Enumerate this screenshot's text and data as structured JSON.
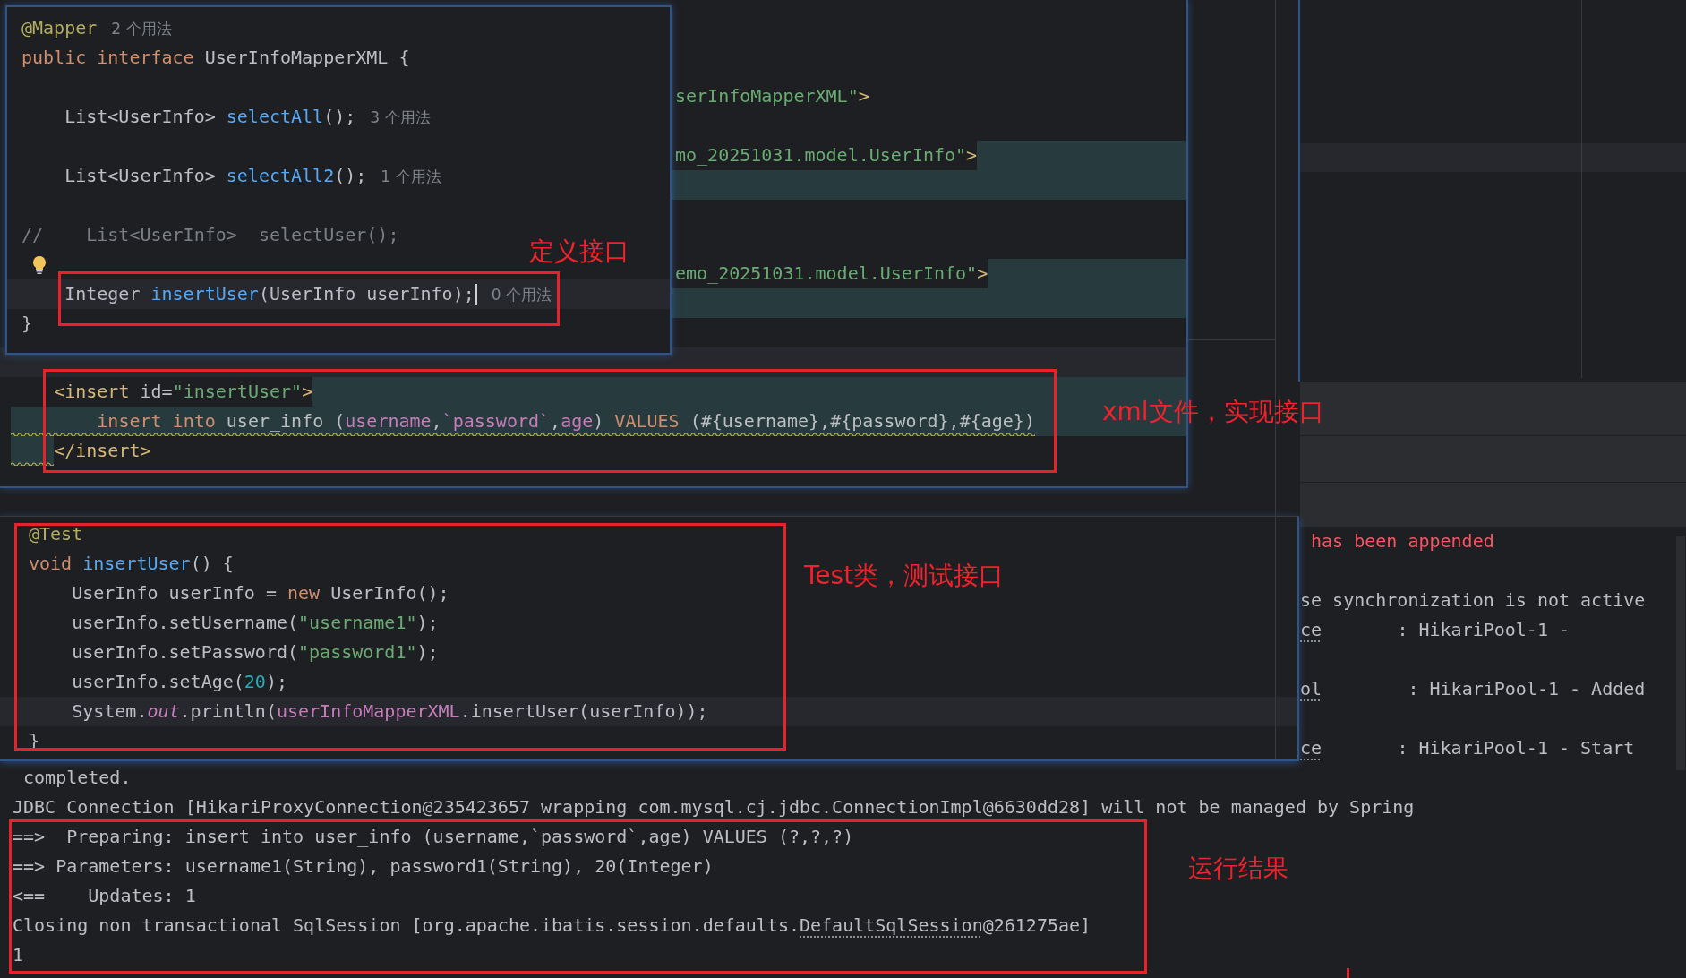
{
  "interface_editor": {
    "note": "定义接口",
    "lines": [
      {
        "kind": "code",
        "current": false,
        "tokens": [
          {
            "kind": "annotation",
            "text": "@Mapper"
          }
        ],
        "hint": "2 个用法"
      },
      {
        "kind": "code",
        "current": false,
        "tokens": [
          {
            "kind": "keyword",
            "text": "public interface"
          },
          {
            "kind": "plain",
            "text": " UserInfoMapperXML {"
          }
        ]
      },
      {
        "kind": "blank",
        "current": false
      },
      {
        "kind": "code",
        "current": false,
        "tokens": [
          {
            "kind": "plain",
            "text": "    List<UserInfo> "
          },
          {
            "kind": "method",
            "text": "selectAll"
          },
          {
            "kind": "plain",
            "text": "();"
          }
        ],
        "hint": "3 个用法"
      },
      {
        "kind": "blank",
        "current": false
      },
      {
        "kind": "code",
        "current": false,
        "tokens": [
          {
            "kind": "plain",
            "text": "    List<UserInfo> "
          },
          {
            "kind": "method",
            "text": "selectAll2"
          },
          {
            "kind": "plain",
            "text": "();"
          }
        ],
        "hint": "1 个用法"
      },
      {
        "kind": "blank",
        "current": false
      },
      {
        "kind": "code",
        "current": false,
        "tokens": [
          {
            "kind": "comment",
            "text": "//    List<UserInfo>  selectUser();"
          }
        ]
      },
      {
        "kind": "bulb",
        "current": false
      },
      {
        "kind": "code",
        "current": true,
        "tokens": [
          {
            "kind": "plain",
            "text": "    Integer "
          },
          {
            "kind": "method",
            "text": "insertUser"
          },
          {
            "kind": "plain",
            "text": "(UserInfo userInfo);"
          },
          {
            "kind": "caret"
          }
        ],
        "hint": "0 个用法"
      },
      {
        "kind": "code",
        "current": false,
        "tokens": [
          {
            "kind": "plain",
            "text": "}"
          }
        ]
      }
    ]
  },
  "xml_editor": {
    "note": "xml文件，实现接口",
    "lines": [
      {
        "kind": "clipped",
        "current": false,
        "band": false,
        "tokens": [
          {
            "kind": "string",
            "text": "serInfoMapperXML\""
          },
          {
            "kind": "tag",
            "text": ">"
          }
        ]
      },
      {
        "kind": "blank",
        "current": false,
        "band": false
      },
      {
        "kind": "clipped",
        "current": false,
        "band": false,
        "tokens": [
          {
            "kind": "string",
            "text": "mo_20251031.model.UserInfo\""
          },
          {
            "kind": "tag",
            "text": ">"
          },
          {
            "kind": "fill"
          }
        ]
      },
      {
        "kind": "clipped",
        "current": false,
        "band": true
      },
      {
        "kind": "blank",
        "current": false,
        "band": false
      },
      {
        "kind": "blank",
        "current": false,
        "band": false
      },
      {
        "kind": "clipped",
        "current": false,
        "band": false,
        "tokens": [
          {
            "kind": "string",
            "text": "emo_20251031.model.UserInfo\""
          },
          {
            "kind": "tag",
            "text": ">"
          },
          {
            "kind": "fill"
          }
        ]
      },
      {
        "kind": "clipped",
        "current": false,
        "band": true
      },
      {
        "kind": "blank",
        "current": false,
        "band": false
      },
      {
        "kind": "blank",
        "current": true,
        "band": false
      },
      {
        "kind": "code",
        "current": false,
        "band": false,
        "tokens": [
          {
            "kind": "tag",
            "text": "    <insert"
          },
          {
            "kind": "plain",
            "text": " id="
          },
          {
            "kind": "string",
            "text": "\"insertUser\""
          },
          {
            "kind": "tag",
            "text": ">"
          },
          {
            "kind": "fill"
          }
        ]
      },
      {
        "kind": "warned",
        "current": false,
        "band": true,
        "tokens": [
          {
            "kind": "keyword",
            "text": "        insert into"
          },
          {
            "kind": "plain",
            "text": " user_info ("
          },
          {
            "kind": "column",
            "text": "username"
          },
          {
            "kind": "plain",
            "text": ","
          },
          {
            "kind": "column",
            "text": "`password`"
          },
          {
            "kind": "plain",
            "text": ","
          },
          {
            "kind": "column",
            "text": "age"
          },
          {
            "kind": "plain",
            "text": ")"
          },
          {
            "kind": "keyword",
            "text": " VALUES"
          },
          {
            "kind": "plain",
            "text": " (#{username},#{password},#{age})"
          }
        ]
      },
      {
        "kind": "indentwarned",
        "current": false,
        "band": false,
        "tokens": [
          {
            "kind": "tag",
            "text": "    </insert>"
          }
        ]
      }
    ]
  },
  "test_editor": {
    "note": "Test类，测试接口",
    "lines": [
      {
        "kind": "code",
        "current": false,
        "tokens": [
          {
            "kind": "annotation",
            "text": "@Test"
          }
        ]
      },
      {
        "kind": "code",
        "current": false,
        "tokens": [
          {
            "kind": "keyword",
            "text": "void"
          },
          {
            "kind": "method",
            "text": " insertUser"
          },
          {
            "kind": "plain",
            "text": "() {"
          }
        ]
      },
      {
        "kind": "code",
        "current": false,
        "tokens": [
          {
            "kind": "plain",
            "text": "    UserInfo userInfo = "
          },
          {
            "kind": "keyword",
            "text": "new"
          },
          {
            "kind": "plain",
            "text": " UserInfo();"
          }
        ]
      },
      {
        "kind": "code",
        "current": false,
        "tokens": [
          {
            "kind": "plain",
            "text": "    userInfo.setUsername("
          },
          {
            "kind": "string",
            "text": "\"username1\""
          },
          {
            "kind": "plain",
            "text": ");"
          }
        ]
      },
      {
        "kind": "code",
        "current": false,
        "tokens": [
          {
            "kind": "plain",
            "text": "    userInfo.setPassword("
          },
          {
            "kind": "string",
            "text": "\"password1\""
          },
          {
            "kind": "plain",
            "text": ");"
          }
        ]
      },
      {
        "kind": "code",
        "current": false,
        "tokens": [
          {
            "kind": "plain",
            "text": "    userInfo.setAge("
          },
          {
            "kind": "number",
            "text": "20"
          },
          {
            "kind": "plain",
            "text": ");"
          }
        ]
      },
      {
        "kind": "code",
        "current": true,
        "tokens": [
          {
            "kind": "plain",
            "text": "    System."
          },
          {
            "kind": "static",
            "text": "out"
          },
          {
            "kind": "plain",
            "text": ".println("
          },
          {
            "kind": "field",
            "text": "userInfoMapperXML"
          },
          {
            "kind": "plain",
            "text": ".insertUser(userInfo));"
          }
        ]
      },
      {
        "kind": "code",
        "current": false,
        "tokens": [
          {
            "kind": "plain",
            "text": "}"
          }
        ]
      }
    ]
  },
  "console": {
    "note": "运行结果",
    "lines": [
      {
        "kind": "clipped",
        "tokens": [
          {
            "kind": "error",
            "text": " has been appended"
          }
        ]
      },
      {
        "kind": "blank"
      },
      {
        "kind": "clipped",
        "tokens": [
          {
            "kind": "plain",
            "text": "se synchronization is not active"
          }
        ]
      },
      {
        "kind": "clipped",
        "tokens": [
          {
            "kind": "link",
            "text": "ce"
          },
          {
            "kind": "plain",
            "text": "       : HikariPool-1 -"
          }
        ]
      },
      {
        "kind": "blank"
      },
      {
        "kind": "clipped",
        "tokens": [
          {
            "kind": "link",
            "text": "ol"
          },
          {
            "kind": "plain",
            "text": "        : HikariPool-1 - Added"
          }
        ]
      },
      {
        "kind": "blank"
      },
      {
        "kind": "clipped",
        "tokens": [
          {
            "kind": "link",
            "text": "ce"
          },
          {
            "kind": "plain",
            "text": "       : HikariPool-1 - Start"
          }
        ]
      },
      {
        "kind": "code",
        "tokens": [
          {
            "kind": "plain",
            "text": " completed."
          }
        ]
      },
      {
        "kind": "code",
        "tokens": [
          {
            "kind": "plain",
            "text": "JDBC Connection [HikariProxyConnection@235423657 wrapping com.mysql.cj.jdbc.ConnectionImpl@6630dd28] will not be managed by Spring"
          }
        ]
      },
      {
        "kind": "code",
        "tokens": [
          {
            "kind": "plain",
            "text": "==>  Preparing: insert into user_info (username,`password`,age) VALUES (?,?,?)"
          }
        ]
      },
      {
        "kind": "code",
        "tokens": [
          {
            "kind": "plain",
            "text": "==> Parameters: username1(String), password1(String), 20(Integer)"
          }
        ]
      },
      {
        "kind": "code",
        "tokens": [
          {
            "kind": "plain",
            "text": "<==    Updates: 1"
          }
        ]
      },
      {
        "kind": "code",
        "tokens": [
          {
            "kind": "plain",
            "text": "Closing non transactional SqlSession [org.apache.ibatis.session.defaults."
          },
          {
            "kind": "link",
            "text": "DefaultSqlSession"
          },
          {
            "kind": "plain",
            "text": "@261275ae]"
          }
        ]
      },
      {
        "kind": "code",
        "tokens": [
          {
            "kind": "plain",
            "text": "1"
          }
        ]
      }
    ]
  }
}
